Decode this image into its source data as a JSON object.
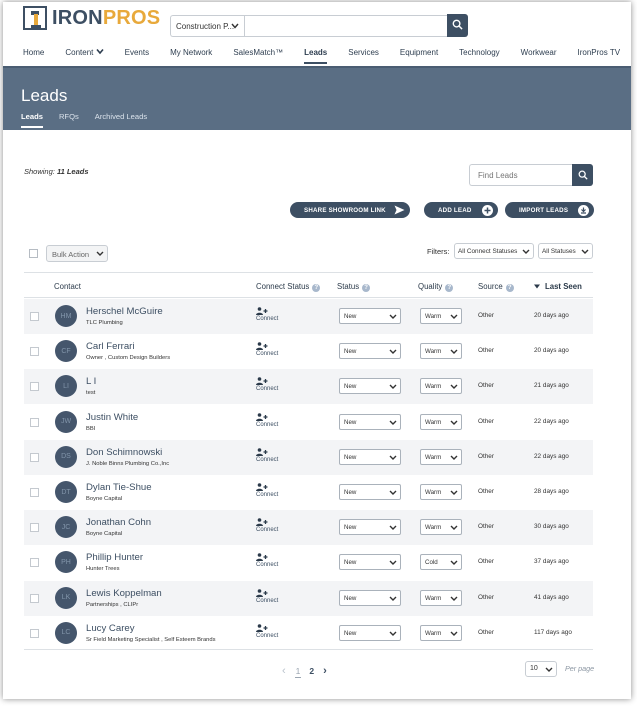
{
  "brand": {
    "part1": "IRON",
    "part2": "PROS"
  },
  "search": {
    "category": "Construction P...",
    "placeholder": ""
  },
  "nav": [
    "Home",
    "Content",
    "Events",
    "My Network",
    "SalesMatch™",
    "Leads",
    "Services",
    "Equipment",
    "Technology",
    "Workwear",
    "IronPros TV"
  ],
  "nav_active": "Leads",
  "page": {
    "title": "Leads",
    "tabs": [
      "Leads",
      "RFQs",
      "Archived Leads"
    ],
    "active_tab": "Leads"
  },
  "showing": {
    "label": "Showing:",
    "count": "11 Leads"
  },
  "find": {
    "placeholder": "Find Leads"
  },
  "actions": {
    "share": "SHARE SHOWROOM LINK",
    "add": "ADD LEAD",
    "import": "IMPORT LEADS"
  },
  "bulk": {
    "label": "Bulk Action"
  },
  "filters": {
    "label": "Filters:",
    "connect": "All Connect Statuses",
    "status": "All Statuses"
  },
  "columns": {
    "contact": "Contact",
    "connect": "Connect Status",
    "status": "Status",
    "quality": "Quality",
    "source": "Source",
    "last_seen": "Last Seen"
  },
  "rows": [
    {
      "initials": "HM",
      "name": "Herschel McGuire",
      "company": "TLC Plumbing",
      "connect": "Connect",
      "status": "New",
      "quality": "Warm",
      "source": "Other",
      "seen": "20 days ago"
    },
    {
      "initials": "CF",
      "name": "Carl Ferrari",
      "company": "Owner , Custom Design Builders",
      "connect": "Connect",
      "status": "New",
      "quality": "Warm",
      "source": "Other",
      "seen": "20 days ago"
    },
    {
      "initials": "LI",
      "name": "L I",
      "company": "test",
      "connect": "Connect",
      "status": "New",
      "quality": "Warm",
      "source": "Other",
      "seen": "21 days ago"
    },
    {
      "initials": "JW",
      "name": "Justin White",
      "company": "BBI",
      "connect": "Connect",
      "status": "New",
      "quality": "Warm",
      "source": "Other",
      "seen": "22 days ago"
    },
    {
      "initials": "DS",
      "name": "Don Schimnowski",
      "company": "J. Noble Binns Plumbing Co.,Inc",
      "connect": "Connect",
      "status": "New",
      "quality": "Warm",
      "source": "Other",
      "seen": "22 days ago"
    },
    {
      "initials": "DT",
      "name": "Dylan Tie-Shue",
      "company": "Boyne Capital",
      "connect": "Connect",
      "status": "New",
      "quality": "Warm",
      "source": "Other",
      "seen": "28 days ago"
    },
    {
      "initials": "JC",
      "name": "Jonathan Cohn",
      "company": "Boyne Capital",
      "connect": "Connect",
      "status": "New",
      "quality": "Warm",
      "source": "Other",
      "seen": "30 days ago"
    },
    {
      "initials": "PH",
      "name": "Phillip Hunter",
      "company": "Hunter Trees",
      "connect": "Connect",
      "status": "New",
      "quality": "Cold",
      "source": "Other",
      "seen": "37 days ago"
    },
    {
      "initials": "LK",
      "name": "Lewis Koppelman",
      "company": "Partnerships , CLIPr",
      "connect": "Connect",
      "status": "New",
      "quality": "Warm",
      "source": "Other",
      "seen": "41 days ago"
    },
    {
      "initials": "LC",
      "name": "Lucy Carey",
      "company": "Sr Field Marketing Specialist , Self Esteem Brands",
      "connect": "Connect",
      "status": "New",
      "quality": "Warm",
      "source": "Other",
      "seen": "117 days ago"
    }
  ],
  "pagination": {
    "pages": [
      "1",
      "2"
    ],
    "current": "1",
    "per_page": "10",
    "per_page_label": "Per page"
  },
  "colors": {
    "primary": "#3d4f63",
    "accent": "#e8a93b",
    "band": "#5a6e84",
    "row_alt": "#f3f4f6"
  }
}
